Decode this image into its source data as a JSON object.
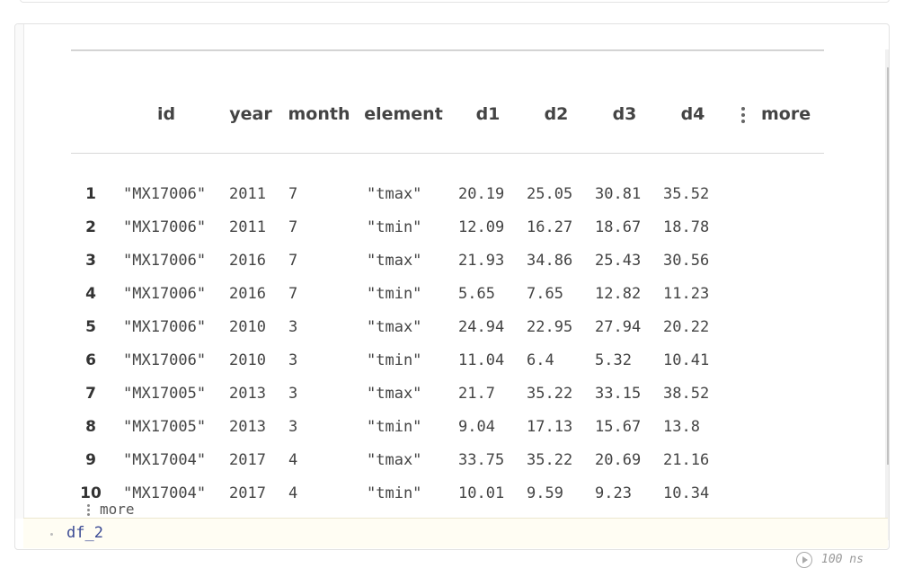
{
  "table": {
    "columns": [
      "id",
      "year",
      "month",
      "element",
      "d1",
      "d2",
      "d3",
      "d4"
    ],
    "more_columns_label": "more",
    "rows": [
      {
        "index": "1",
        "cells": [
          "\"MX17006\"",
          "2011",
          "7",
          "\"tmax\"",
          "20.19",
          "25.05",
          "30.81",
          "35.52"
        ]
      },
      {
        "index": "2",
        "cells": [
          "\"MX17006\"",
          "2011",
          "7",
          "\"tmin\"",
          "12.09",
          "16.27",
          "18.67",
          "18.78"
        ]
      },
      {
        "index": "3",
        "cells": [
          "\"MX17006\"",
          "2016",
          "7",
          "\"tmax\"",
          "21.93",
          "34.86",
          "25.43",
          "30.56"
        ]
      },
      {
        "index": "4",
        "cells": [
          "\"MX17006\"",
          "2016",
          "7",
          "\"tmin\"",
          "5.65",
          "7.65",
          "12.82",
          "11.23"
        ]
      },
      {
        "index": "5",
        "cells": [
          "\"MX17006\"",
          "2010",
          "3",
          "\"tmax\"",
          "24.94",
          "22.95",
          "27.94",
          "20.22"
        ]
      },
      {
        "index": "6",
        "cells": [
          "\"MX17006\"",
          "2010",
          "3",
          "\"tmin\"",
          "11.04",
          "6.4",
          "5.32",
          "10.41"
        ]
      },
      {
        "index": "7",
        "cells": [
          "\"MX17005\"",
          "2013",
          "3",
          "\"tmax\"",
          "21.7",
          "35.22",
          "33.15",
          "38.52"
        ]
      },
      {
        "index": "8",
        "cells": [
          "\"MX17005\"",
          "2013",
          "3",
          "\"tmin\"",
          "9.04",
          "17.13",
          "15.67",
          "13.8"
        ]
      },
      {
        "index": "9",
        "cells": [
          "\"MX17004\"",
          "2017",
          "4",
          "\"tmax\"",
          "33.75",
          "35.22",
          "20.69",
          "21.16"
        ]
      },
      {
        "index": "10",
        "cells": [
          "\"MX17004\"",
          "2017",
          "4",
          "\"tmin\"",
          "10.01",
          "9.59",
          "9.23",
          "10.34"
        ]
      }
    ],
    "more_rows_label": "more"
  },
  "input_cell": {
    "code": "df_2"
  },
  "runtime": {
    "label": "100 ns",
    "icon": "play-circle-icon"
  }
}
